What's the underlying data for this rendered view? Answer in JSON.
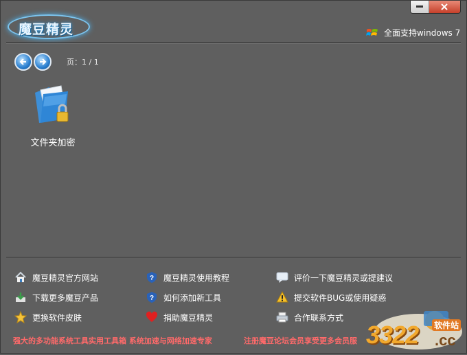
{
  "app": {
    "logo_text": "魔豆精灵",
    "win7_text": "全面支持windows 7"
  },
  "pager": {
    "label": "页：1 / 1"
  },
  "tools": [
    {
      "label": "文件夹加密",
      "icon": "locked-folder-icon"
    }
  ],
  "links": [
    {
      "label": "魔豆精灵官方网站",
      "icon": "home-icon"
    },
    {
      "label": "魔豆精灵使用教程",
      "icon": "help-shield-icon"
    },
    {
      "label": "评价一下魔豆精灵或提建议",
      "icon": "speech-bubble-icon"
    },
    {
      "label": "下载更多魔豆产品",
      "icon": "download-icon"
    },
    {
      "label": "如何添加新工具",
      "icon": "help-shield-icon"
    },
    {
      "label": "提交软件BUG或使用疑惑",
      "icon": "warning-icon"
    },
    {
      "label": "更换软件皮肤",
      "icon": "star-icon"
    },
    {
      "label": "捐助魔豆精灵",
      "icon": "heart-icon"
    },
    {
      "label": "合作联系方式",
      "icon": "printer-icon"
    }
  ],
  "footer": {
    "slogan_left": "强大的多功能系统工具实用工具箱 系统加速与网络加速专家",
    "slogan_right": "注册魔豆论坛会员享受更多会员服"
  },
  "watermark": {
    "number": "3322",
    "tld": ".cc",
    "tag": "软件站"
  },
  "colors": {
    "background": "#5f5f5f",
    "slogan": "#ff6a6a",
    "accent": "#2a7fd0",
    "close": "#c6402a"
  }
}
